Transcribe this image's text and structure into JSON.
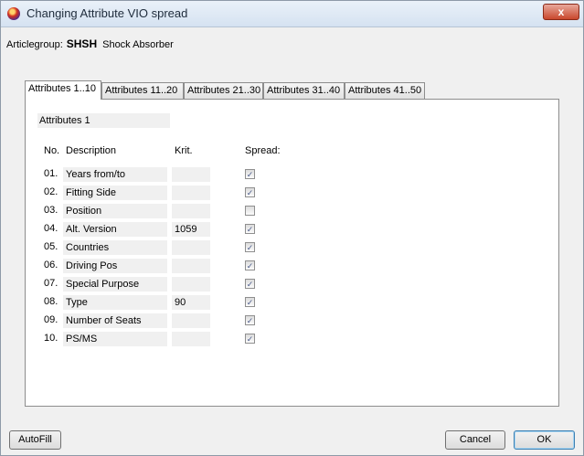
{
  "window": {
    "title": "Changing Attribute VIO spread",
    "close_label": "x"
  },
  "article": {
    "label": "Articlegroup:",
    "code": "SHSH",
    "name": "Shock Absorber"
  },
  "tabs": [
    "Attributes 1..10",
    "Attributes 11..20",
    "Attributes 21..30",
    "Attributes 31..40",
    "Attributes 41..50"
  ],
  "section": {
    "label": "Attributes 1"
  },
  "headers": {
    "no": "No.",
    "description": "Description",
    "krit": "Krit.",
    "spread": "Spread:"
  },
  "rows": [
    {
      "no": "01.",
      "description": "Years from/to",
      "krit": "",
      "spread": true
    },
    {
      "no": "02.",
      "description": "Fitting Side",
      "krit": "",
      "spread": true
    },
    {
      "no": "03.",
      "description": "Position",
      "krit": "",
      "spread": false
    },
    {
      "no": "04.",
      "description": "Alt. Version",
      "krit": "1059",
      "spread": true
    },
    {
      "no": "05.",
      "description": "Countries",
      "krit": "",
      "spread": true
    },
    {
      "no": "06.",
      "description": "Driving Pos",
      "krit": "",
      "spread": true
    },
    {
      "no": "07.",
      "description": "Special Purpose",
      "krit": "",
      "spread": true
    },
    {
      "no": "08.",
      "description": "Type",
      "krit": "90",
      "spread": true
    },
    {
      "no": "09.",
      "description": "Number of Seats",
      "krit": "",
      "spread": true
    },
    {
      "no": "10.",
      "description": "PS/MS",
      "krit": "",
      "spread": true
    }
  ],
  "buttons": {
    "autofill": "AutoFill",
    "cancel": "Cancel",
    "ok": "OK"
  },
  "check_glyph": "✓"
}
